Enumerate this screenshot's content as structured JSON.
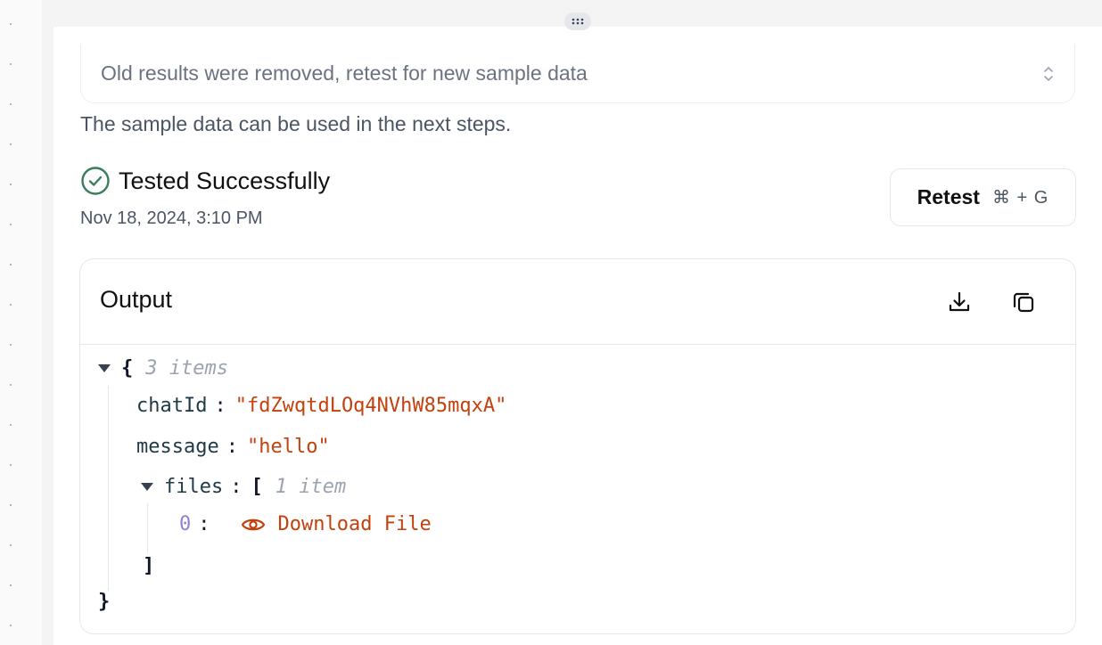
{
  "sample_select": {
    "text": "Old results were removed, retest for new sample data",
    "icon": "chevron-up-down-icon"
  },
  "helper_text": "The sample data can be used in the next steps.",
  "test_status": {
    "label": "Tested Successfully",
    "timestamp": "Nov 18, 2024, 3:10 PM",
    "icon": "check-circle-icon",
    "color": "#3a7d5c"
  },
  "retest_button": {
    "label": "Retest",
    "shortcut": "⌘ + G"
  },
  "output": {
    "title": "Output",
    "actions": [
      "download-icon",
      "copy-icon"
    ],
    "json": {
      "open_brace": "{",
      "close_brace": "}",
      "items_count": "3 items",
      "fields": [
        {
          "key": "chatId",
          "colon": ":",
          "value": "\"fdZwqtdLOq4NVhW85mqxA\""
        },
        {
          "key": "message",
          "colon": ":",
          "value": "\"hello\""
        }
      ],
      "files": {
        "key": "files",
        "colon": ":",
        "open_bracket": "[",
        "close_bracket": "]",
        "count": "1 item",
        "entries": [
          {
            "index": "0",
            "colon": ":",
            "link_label": "Download File",
            "icon": "eye-icon"
          }
        ]
      }
    }
  },
  "colors": {
    "accent_string": "#c2410c",
    "success": "#3a7d5c",
    "index": "#8b83d6"
  }
}
